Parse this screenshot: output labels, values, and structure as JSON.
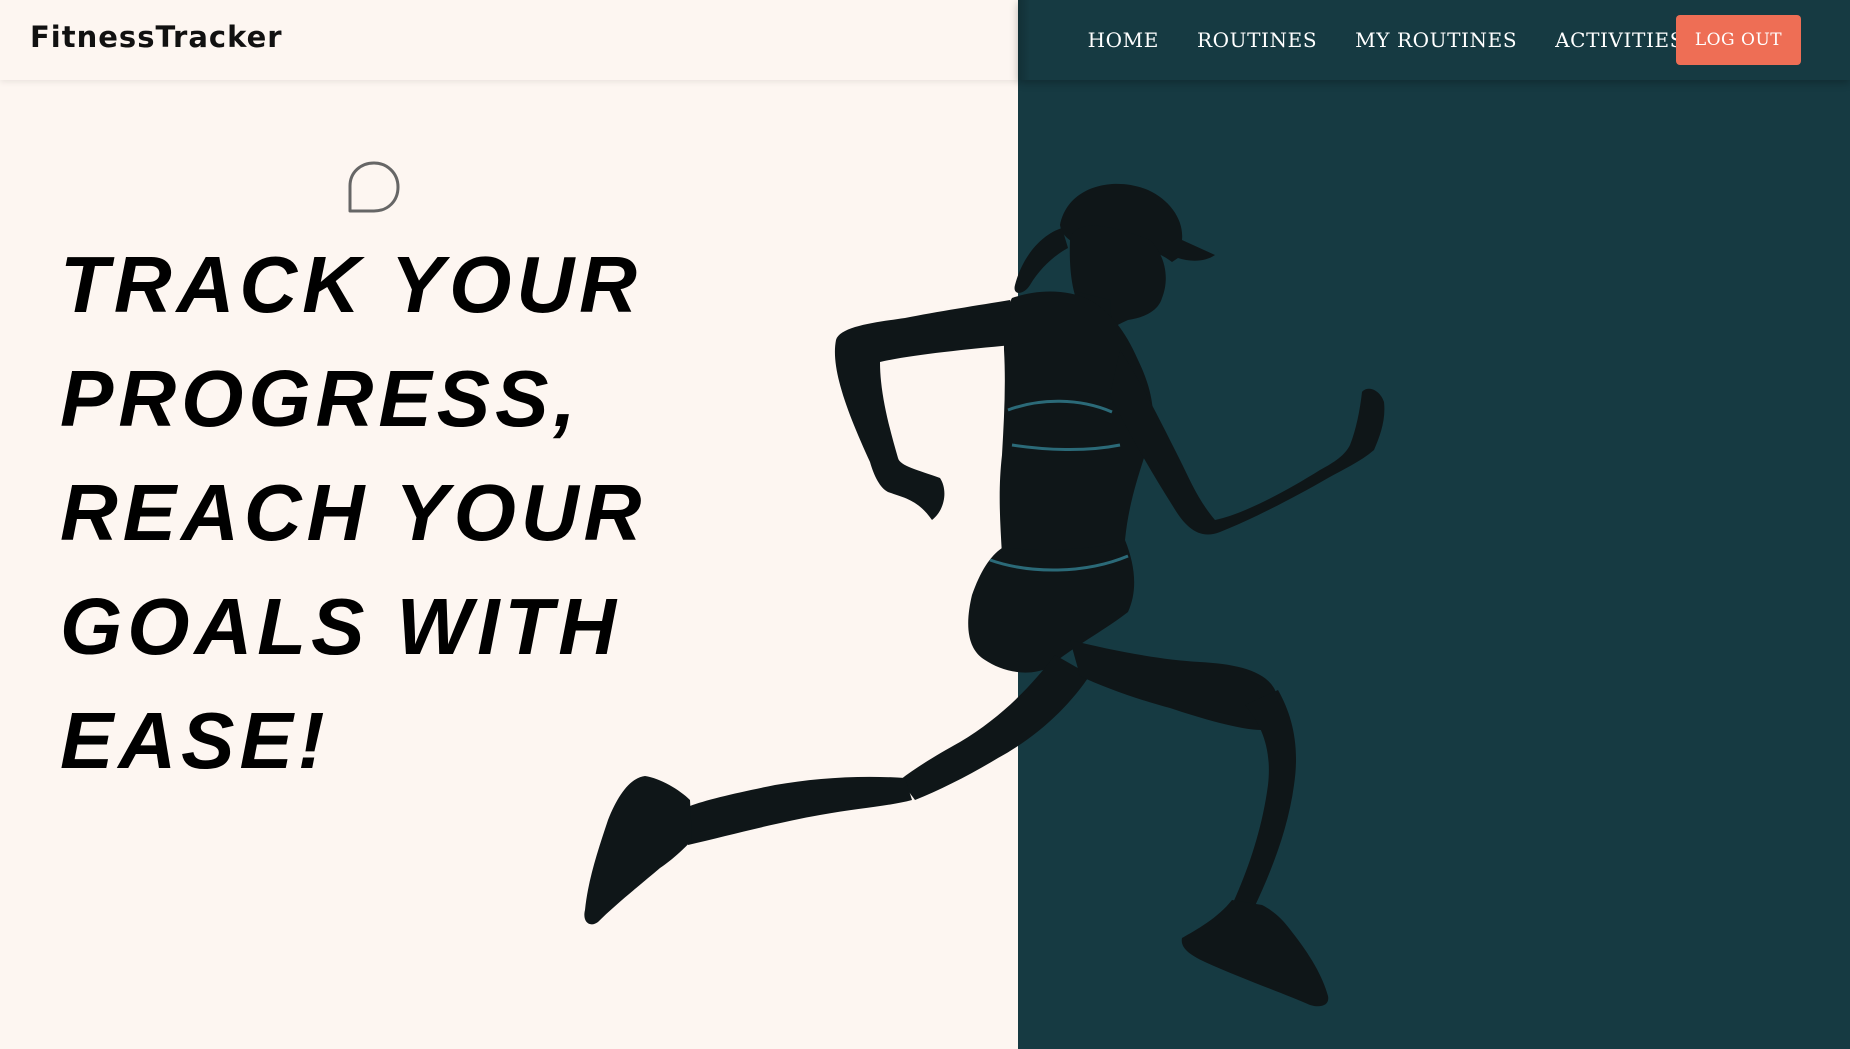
{
  "app": {
    "brand": "FitnessTracker"
  },
  "nav": {
    "items": [
      {
        "label": "HOME"
      },
      {
        "label": "ROUTINES"
      },
      {
        "label": "MY ROUTINES"
      },
      {
        "label": "ACTIVITIES"
      }
    ],
    "logout_label": "LOG OUT"
  },
  "hero": {
    "lines": [
      "TRACK YOUR",
      "PROGRESS,",
      "REACH YOUR",
      "GOALS WITH",
      "EASE!"
    ],
    "image_icon": "runner-silhouette-icon",
    "chat_icon": "chat-bubble-icon"
  },
  "colors": {
    "left_background": "#fdf6f1",
    "right_background": "#163a42",
    "logout_button": "#ee6e55",
    "nav_text": "#ffffff",
    "heading_text": "#000000"
  }
}
